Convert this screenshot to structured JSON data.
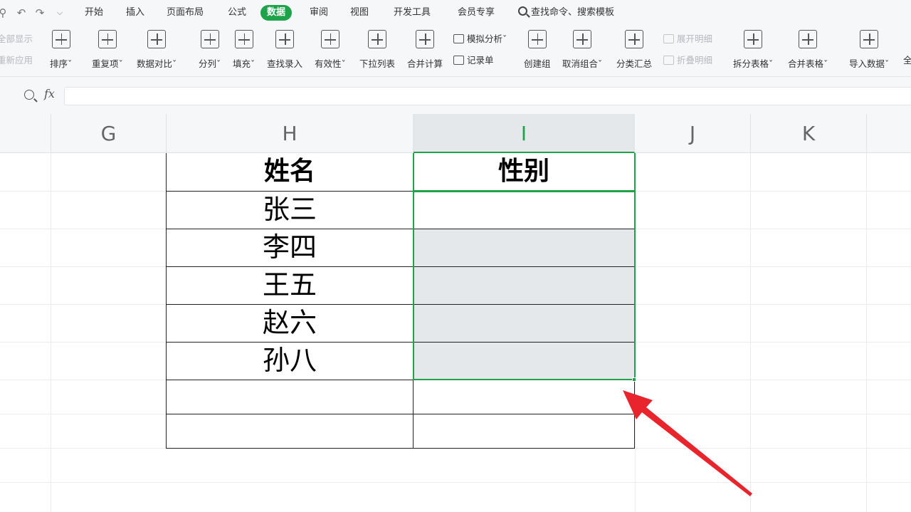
{
  "quick_access": [
    "find-icon",
    "undo-icon",
    "redo-icon",
    "dropdown-icon"
  ],
  "menu": {
    "tabs": [
      "开始",
      "插入",
      "页面布局",
      "公式",
      "数据",
      "审阅",
      "视图",
      "开发工具",
      "会员专享"
    ],
    "active_tab": "数据",
    "search_label": "查找命令、搜索模板"
  },
  "ribbon": {
    "partial_top": "全部显示",
    "partial_bottom": "重新应用",
    "sort": "排序",
    "dedup": "重复项",
    "compare": "数据对比",
    "split_col": "分列",
    "fill": "填充",
    "lookup_entry": "查找录入",
    "validity": "有效性",
    "dropdown_list": "下拉列表",
    "consolidate": "合并计算",
    "simulate": "模拟分析",
    "record_form": "记录单",
    "create_group": "创建组",
    "ungroup": "取消组合",
    "subtotal": "分类汇总",
    "expand_detail": "展开明细",
    "collapse_detail": "折叠明细",
    "split_table": "拆分表格",
    "merge_table": "合并表格",
    "import_data": "导入数据",
    "cut_next": "全"
  },
  "formula_bar": {
    "fx_label": "fx",
    "value": ""
  },
  "sheet": {
    "columns": [
      "G",
      "H",
      "I",
      "J",
      "K"
    ],
    "selected_column": "I",
    "table": {
      "headers": [
        "姓名",
        "性别"
      ],
      "names": [
        "张三",
        "李四",
        "王五",
        "赵六",
        "孙八"
      ]
    }
  },
  "colors": {
    "accent_green": "#1ea24a",
    "arrow_red": "#e8242c",
    "selection_tint": "#e5e8eb"
  }
}
